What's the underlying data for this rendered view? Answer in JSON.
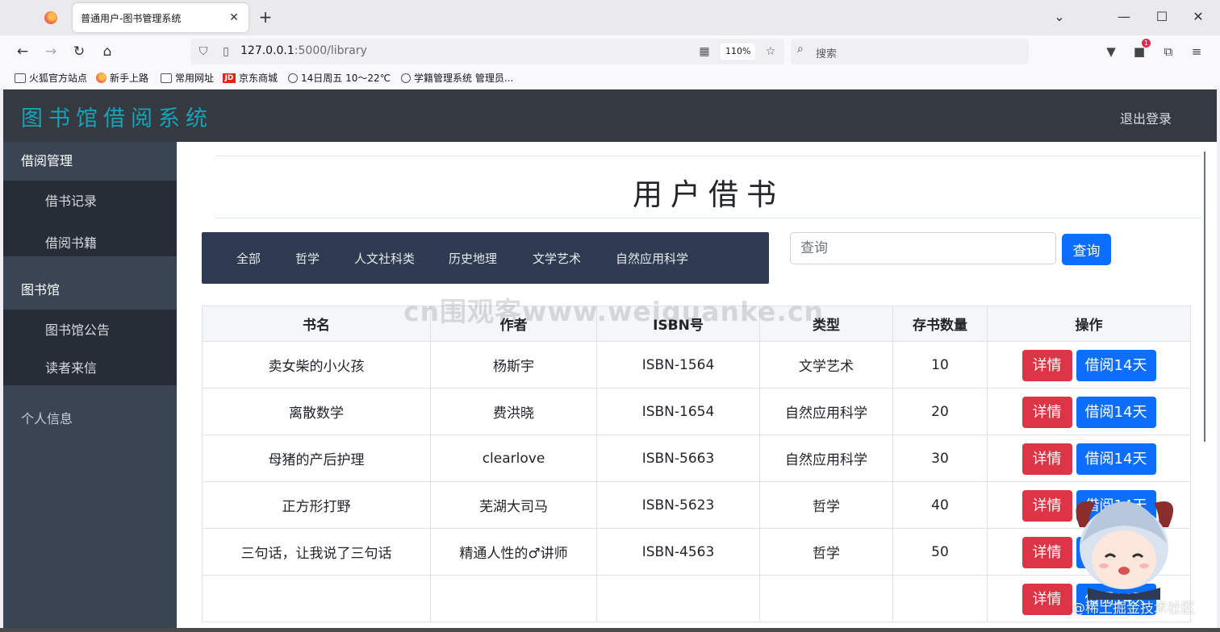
{
  "browser": {
    "tab_title": "普通用户-图书管理系统",
    "new_tab_glyph": "+",
    "url_host": "127.0.0.1",
    "url_rest": ":5000/library",
    "zoom": "110%",
    "search_placeholder": "搜索",
    "extension_badge": "1",
    "bookmarks": [
      "火狐官方站点",
      "新手上路",
      "常用网址",
      "京东商城",
      "14日周五  10～22℃",
      "学籍管理系统 管理员..."
    ],
    "jd_logo": "JD"
  },
  "app": {
    "brand": "图书馆借阅系统",
    "logout": "退出登录",
    "sidebar": {
      "group1": "借阅管理",
      "group1_items": [
        "借书记录",
        "借阅书籍"
      ],
      "group2": "图书馆",
      "group2_items": [
        "图书馆公告",
        "读者来信"
      ],
      "profile": "个人信息"
    },
    "page_title": "用户借书",
    "categories": [
      "全部",
      "哲学",
      "人文社科类",
      "历史地理",
      "文学艺术",
      "自然应用科学"
    ],
    "search": {
      "placeholder": "查询",
      "button": "查询"
    },
    "table": {
      "headers": [
        "书名",
        "作者",
        "ISBN号",
        "类型",
        "存书数量",
        "操作"
      ],
      "detail_label": "详情",
      "borrow_label": "借阅14天",
      "rows": [
        [
          "卖女柴的小火孩",
          "杨斯宇",
          "ISBN-1564",
          "文学艺术",
          "10"
        ],
        [
          "离散数学",
          "费洪晓",
          "ISBN-1654",
          "自然应用科学",
          "20"
        ],
        [
          "母猪的产后护理",
          "clearlove",
          "ISBN-5663",
          "自然应用科学",
          "30"
        ],
        [
          "正方形打野",
          "芜湖大司马",
          "ISBN-5623",
          "哲学",
          "40"
        ],
        [
          "三句话，让我说了三句话",
          "精通人性的♂讲师",
          "ISBN-4563",
          "哲学",
          "50"
        ],
        [
          "",
          "",
          "",
          "",
          ""
        ]
      ]
    }
  },
  "watermarks": {
    "top": "cn围观客www.weiguanke.cn",
    "bottom": "@稀土掘金技术社区"
  },
  "colors": {
    "header_bg": "#343a40",
    "brand": "#17a2b8",
    "sidebar_bg": "#3b4453",
    "sidebar_item_bg": "#272d36",
    "category_bar": "#2e3a4f",
    "primary": "#0d6efd",
    "danger": "#dc3545"
  }
}
